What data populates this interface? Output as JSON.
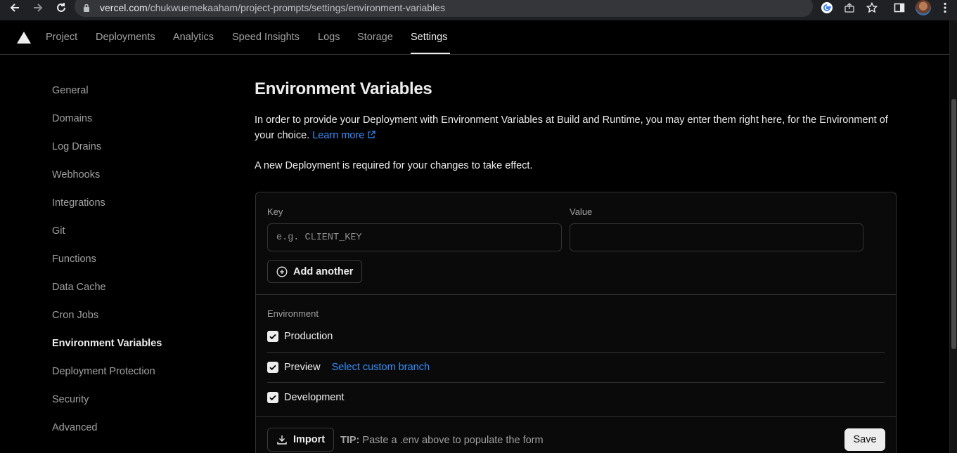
{
  "browser": {
    "url_host": "vercel.com",
    "url_path": "/chukwuemekaaham/project-prompts/settings/environment-variables"
  },
  "topnav": {
    "tabs": [
      {
        "label": "Project"
      },
      {
        "label": "Deployments"
      },
      {
        "label": "Analytics"
      },
      {
        "label": "Speed Insights"
      },
      {
        "label": "Logs"
      },
      {
        "label": "Storage"
      },
      {
        "label": "Settings",
        "active": true
      }
    ]
  },
  "sidebar": {
    "items": [
      {
        "label": "General"
      },
      {
        "label": "Domains"
      },
      {
        "label": "Log Drains"
      },
      {
        "label": "Webhooks"
      },
      {
        "label": "Integrations"
      },
      {
        "label": "Git"
      },
      {
        "label": "Functions"
      },
      {
        "label": "Data Cache"
      },
      {
        "label": "Cron Jobs"
      },
      {
        "label": "Environment Variables",
        "active": true
      },
      {
        "label": "Deployment Protection"
      },
      {
        "label": "Security"
      },
      {
        "label": "Advanced"
      }
    ]
  },
  "main": {
    "title": "Environment Variables",
    "description": "In order to provide your Deployment with Environment Variables at Build and Runtime, you may enter them right here, for the Environment of your choice.",
    "learn_more": "Learn more",
    "notice": "A new Deployment is required for your changes to take effect.",
    "form": {
      "key_label": "Key",
      "key_placeholder": "e.g. CLIENT_KEY",
      "key_value": "",
      "value_label": "Value",
      "value_value": "",
      "add_another": "Add another",
      "environment_label": "Environment",
      "environments": [
        {
          "label": "Production",
          "checked": true
        },
        {
          "label": "Preview",
          "checked": true,
          "link": "Select custom branch"
        },
        {
          "label": "Development",
          "checked": true
        }
      ],
      "import_label": "Import",
      "tip_prefix": "TIP:",
      "tip_text": "Paste a .env above to populate the form",
      "save_label": "Save"
    }
  },
  "colors": {
    "background": "#000000",
    "card": "#0a0a0a",
    "border": "#333333",
    "text": "#ededed",
    "muted": "#a1a1a1",
    "link": "#3291ff"
  }
}
